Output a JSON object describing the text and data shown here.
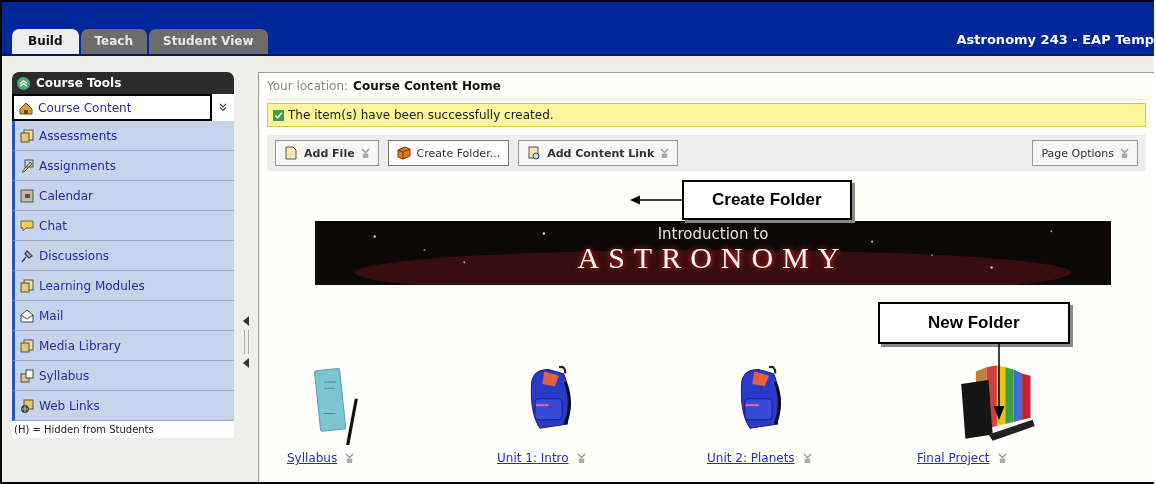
{
  "header": {
    "tabs": [
      {
        "label": "Build",
        "selected": true
      },
      {
        "label": "Teach",
        "selected": false
      },
      {
        "label": "Student View",
        "selected": false
      }
    ],
    "course_title": "Astronomy 243 - EAP Temp"
  },
  "sidebar": {
    "title": "Course Tools",
    "items": [
      {
        "label": "Course Content",
        "selected": true
      },
      {
        "label": "Assessments",
        "selected": false
      },
      {
        "label": "Assignments",
        "selected": false
      },
      {
        "label": "Calendar",
        "selected": false
      },
      {
        "label": "Chat",
        "selected": false
      },
      {
        "label": "Discussions",
        "selected": false
      },
      {
        "label": "Learning Modules",
        "selected": false
      },
      {
        "label": "Mail",
        "selected": false
      },
      {
        "label": "Media Library",
        "selected": false
      },
      {
        "label": "Syllabus",
        "selected": false
      },
      {
        "label": "Web Links",
        "selected": false
      }
    ],
    "footnote": "(H) = Hidden from Students"
  },
  "location": {
    "label": "Your location:",
    "value": "Course Content Home"
  },
  "message": "The item(s) have been successfully created.",
  "toolbar": [
    {
      "label": "Add File",
      "menu": true,
      "bold": true
    },
    {
      "label": "Create Folder...",
      "menu": false,
      "bold": false
    },
    {
      "label": "Add Content Link",
      "menu": true,
      "bold": true
    },
    {
      "label": "Page Options",
      "menu": true,
      "bold": false
    }
  ],
  "banner": {
    "line_1": "Introduction to",
    "line_2": "ASTRONOMY"
  },
  "items": [
    {
      "title": "Syllabus",
      "kind": "syllabus"
    },
    {
      "title": "Unit 1: Intro",
      "kind": "backpack"
    },
    {
      "title": "Unit 2: Planets",
      "kind": "backpack"
    },
    {
      "title": "Final Project",
      "kind": "organizer"
    }
  ],
  "callouts": [
    {
      "text": "Create Folder"
    },
    {
      "text": "New Folder"
    }
  ]
}
